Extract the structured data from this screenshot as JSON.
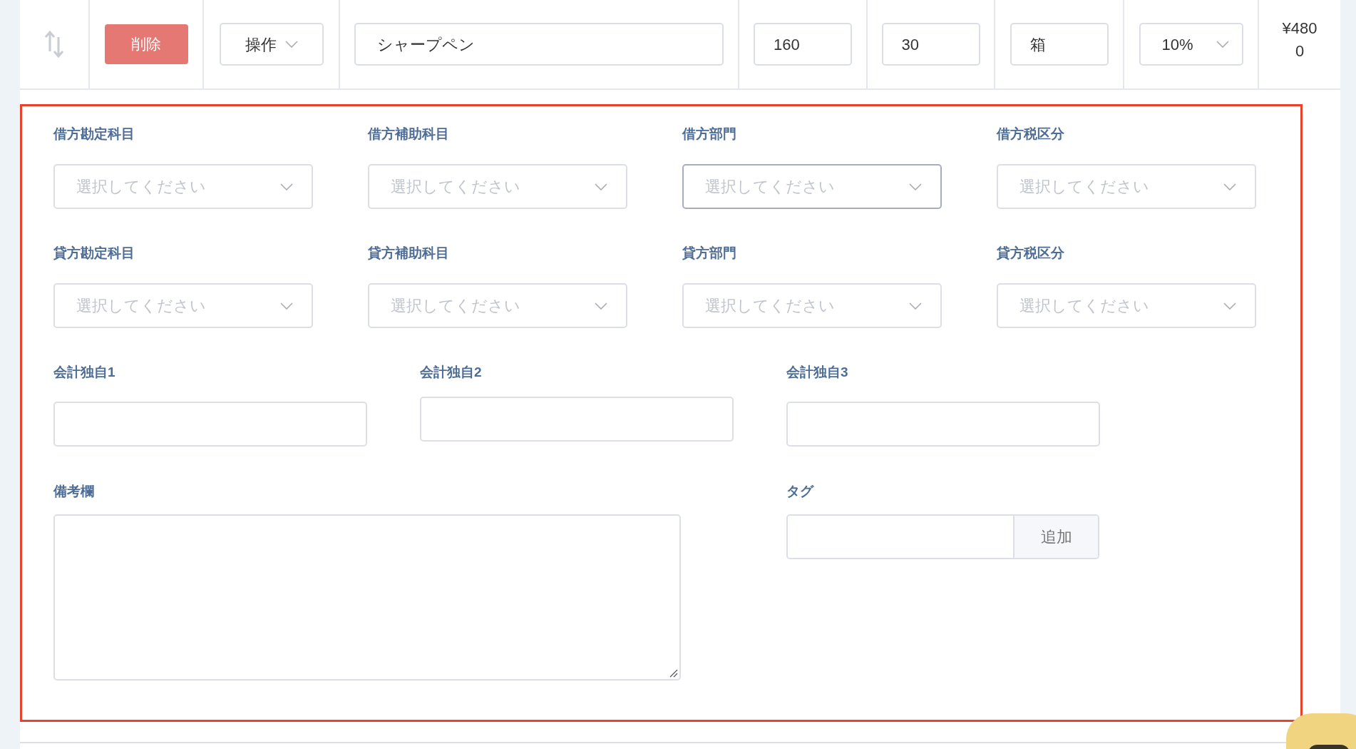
{
  "item_row": {
    "cells": [
      {
        "kind": "sort"
      },
      {
        "kind": "button",
        "text": "削除"
      },
      {
        "kind": "dropdown",
        "text": "操作"
      },
      {
        "kind": "input",
        "value": "シャープペン"
      },
      {
        "kind": "input",
        "value": "160"
      },
      {
        "kind": "input",
        "value": "30"
      },
      {
        "kind": "input",
        "value": "箱"
      },
      {
        "kind": "select",
        "value": "10%"
      },
      {
        "kind": "text",
        "text": "¥4800"
      }
    ]
  },
  "detail_form": {
    "select_rows": [
      [
        {
          "label": "借方勘定科目",
          "placeholder": "選択してください",
          "focused": false
        },
        {
          "label": "借方補助科目",
          "placeholder": "選択してください",
          "focused": false
        },
        {
          "label": "借方部門",
          "placeholder": "選択してください",
          "focused": true
        },
        {
          "label": "借方税区分",
          "placeholder": "選択してください",
          "focused": false
        }
      ],
      [
        {
          "label": "貸方勘定科目",
          "placeholder": "選択してください",
          "focused": false
        },
        {
          "label": "貸方補助科目",
          "placeholder": "選択してください",
          "focused": false
        },
        {
          "label": "貸方部門",
          "placeholder": "選択してください",
          "focused": false
        },
        {
          "label": "貸方税区分",
          "placeholder": "選択してください",
          "focused": false
        }
      ]
    ],
    "custom_fields": [
      {
        "label": "会計独自1"
      },
      {
        "label": "会計独自2"
      },
      {
        "label": "会計独自3"
      }
    ],
    "remarks": {
      "label": "備考欄"
    },
    "tag": {
      "label": "タグ",
      "button": "追加"
    }
  }
}
